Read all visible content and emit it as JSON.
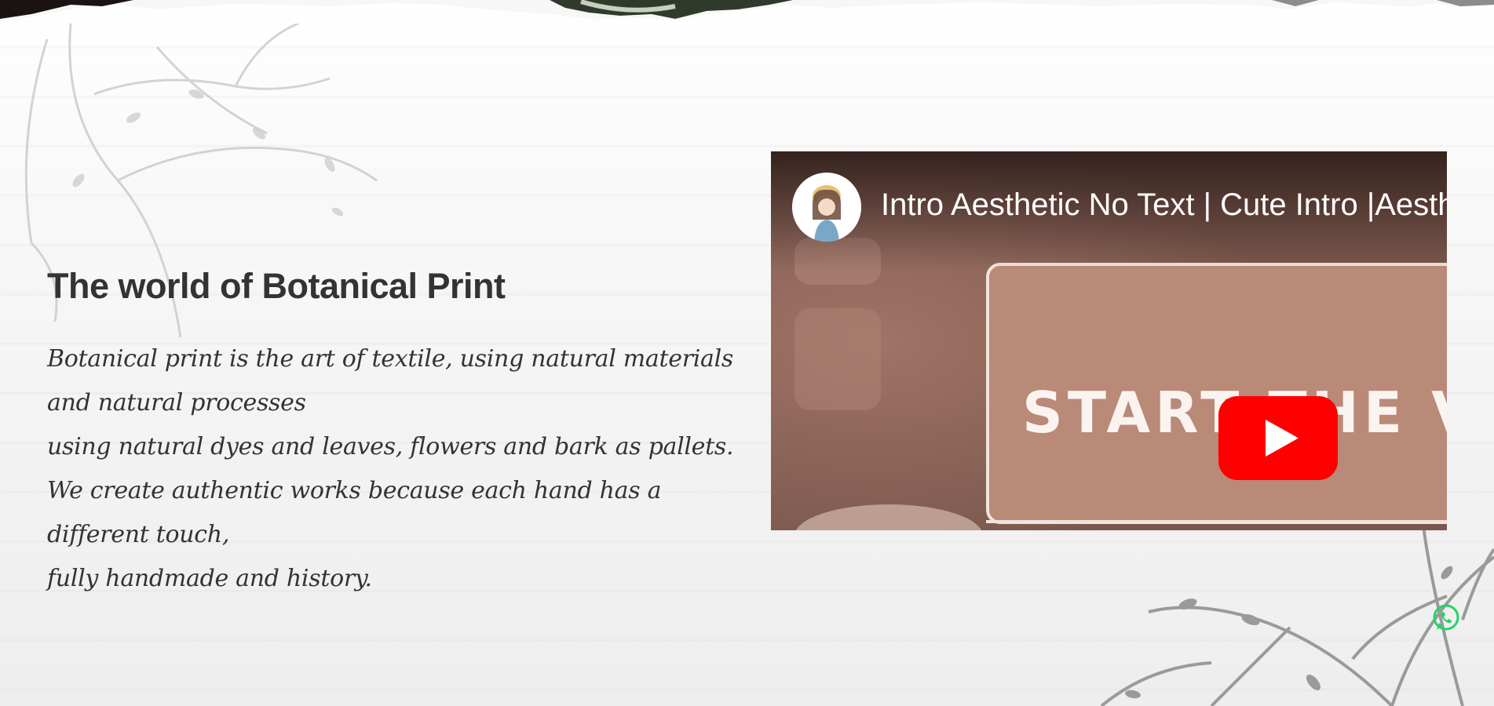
{
  "colors": {
    "text": "#333333",
    "youtube_red": "#ff0000",
    "whatsapp_green": "#25d366",
    "video_brown": "#8b6457"
  },
  "section": {
    "title": "The world of Botanical Print",
    "paragraph_lines": [
      "Botanical print is the art of textile, using natural materials and natural processes",
      "using natural dyes and leaves, flowers and bark as pallets.",
      "We create authentic works because each hand has a different touch,",
      "fully handmade and history."
    ]
  },
  "video": {
    "title": "Intro Aesthetic No Text | Cute Intro |Aesthetic",
    "thumbnail_text": "START THE VIDEO",
    "play_icon": "youtube-play-icon",
    "channel_avatar_icon": "channel-avatar"
  },
  "floating": {
    "whatsapp_icon": "whatsapp-icon"
  }
}
